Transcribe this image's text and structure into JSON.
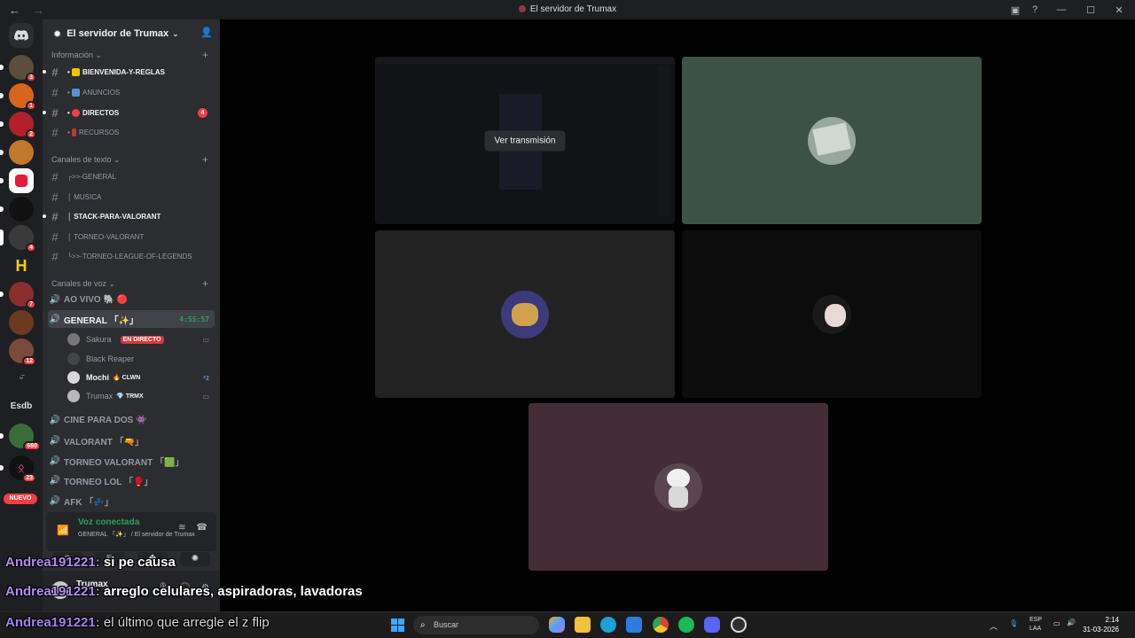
{
  "window": {
    "title": "El servidor de Trumax",
    "back_icon": "arrow-left-icon",
    "forward_icon": "arrow-right-icon",
    "minimize": "—",
    "maximize": "☐",
    "close": "✕"
  },
  "guilds": {
    "badges": {
      "g1": "3",
      "g2": "1",
      "g3": "2",
      "g8": "4",
      "g10": "7",
      "g12": "12",
      "g14": "660",
      "g15": "23"
    },
    "esdb": "Esdb",
    "nuevo": "NUEVO"
  },
  "server": {
    "name": "El servidor de Trumax",
    "categories": {
      "info": "Información",
      "text": "Canales de texto",
      "voice": "Canales de voz"
    },
    "info_channels": [
      {
        "name": "BIENVENIDA-Y-REGLAS",
        "emoji_color": "#f5c400",
        "bold": true
      },
      {
        "name": "ANUNCIOS",
        "emoji_color": "#5b8fd6",
        "bold": false
      },
      {
        "name": "DIRECTOS",
        "emoji_color": "#f23f43",
        "bold": true,
        "count": "4"
      },
      {
        "name": "RECURSOS",
        "emoji_color": "#c0392b",
        "bold": false
      }
    ],
    "text_channels": [
      {
        "name": "╭>>-GENERAL",
        "bold": false
      },
      {
        "name": "│ MUSICA",
        "bold": false
      },
      {
        "name": "│ STACK-PARA-VALORANT",
        "bold": true
      },
      {
        "name": "│ TORNEO-VALORANT",
        "bold": false
      },
      {
        "name": "╰>>-TORNEO-LEAGUE-OF-LEGENDS",
        "bold": false
      }
    ],
    "voice_channels": {
      "ao_vivo": "AO VIVO 🐘 🔴",
      "general": "GENERAL 「✨」",
      "general_timer": "4:55:57",
      "cine": "CINE PARA DOS 👾",
      "valorant": "VALORANT 「🔫」",
      "torneo_valorant": "TORNEO VALORANT 「🟩」",
      "torneo_lol": "TORNEO LOL 「🥊」",
      "afk": "AFK 「💤」"
    },
    "members": [
      {
        "name": "Sakura",
        "tag": "EN DIRECTO",
        "highlight": false
      },
      {
        "name": "Black Reaper",
        "tag": "",
        "highlight": false
      },
      {
        "name": "Mochi",
        "tag": "🔥 CLWN",
        "highlight": true
      },
      {
        "name": "Trumax",
        "tag": "💎 TRMX",
        "highlight": false
      }
    ]
  },
  "voice_status": {
    "title": "Voz conectada",
    "channel": "GENERAL 「✨」 / El servidor de Trumax"
  },
  "user": {
    "name": "Trumax"
  },
  "stage": {
    "stream_button": "Ver transmisión",
    "tile_colors": {
      "stream": "#1c1e24",
      "green": "#3d5246",
      "dark": "#222222",
      "black": "#0c0c0c",
      "mauve": "#452d37"
    }
  },
  "chat_overlay": [
    {
      "user": "Andrea191221:",
      "text": " si pe causa"
    },
    {
      "user": "Andrea191221:",
      "text": " arreglo celulares, aspiradoras, lavadoras"
    },
    {
      "user": "Andrea191221:",
      "text": " el último que arregle el z flip"
    }
  ],
  "taskbar": {
    "search_placeholder": "Buscar",
    "lang": "ESP",
    "lang_sub": "LAA",
    "time": "2:14",
    "date": "31-03-2026"
  }
}
